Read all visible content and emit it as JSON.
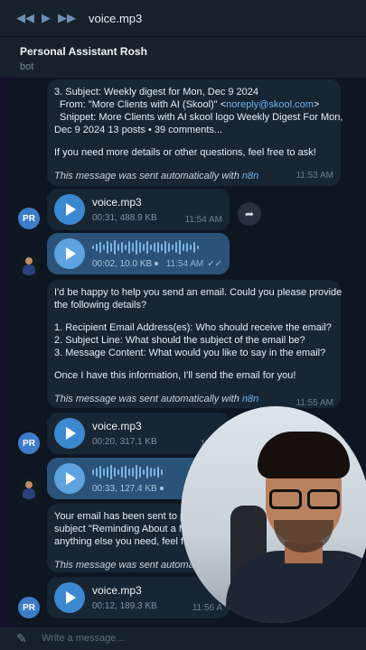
{
  "player": {
    "title": "voice.mp3"
  },
  "chat": {
    "name": "Personal Assistant Rosh",
    "subtitle": "bot"
  },
  "bot_avatar_initials": "PR",
  "messages": {
    "m1": {
      "lines": [
        "3. Subject: Weekly digest for Mon, Dec 9 2024",
        "From: \"More Clients with AI (Skool)\" <",
        "noreply@skool.com",
        ">",
        "Snippet: More Clients with AI skool logo Weekly Digest For Mon,",
        "Dec 9 2024 13 posts • 39 comments...",
        "If you need more details or other questions, feel free to ask!"
      ],
      "footer": "This message was sent automatically with ",
      "footer_link": "n8n",
      "time": "11:53 AM"
    },
    "v1": {
      "name": "voice.mp3",
      "meta": "00:31, 488.9 KB",
      "time": "11:54 AM"
    },
    "uv1": {
      "meta": "00:02, 10.0 KB",
      "time": "11:54 AM"
    },
    "m2": {
      "lines": [
        "I'd be happy to help you send an email. Could you please provide",
        "the following details?",
        "1. Recipient Email Address(es): Who should receive the email?",
        "2. Subject Line: What should the subject of the email be?",
        "3. Message Content: What would you like to say in the email?",
        "Once I have this information, I'll send the email for you!"
      ],
      "footer": "This message was sent automatically with ",
      "footer_link": "n8n",
      "time": "11:55 AM"
    },
    "v2": {
      "name": "voice.mp3",
      "meta": "00:20, 317.1 KB",
      "time": "11:55"
    },
    "uv2": {
      "meta": "00:33, 127.4 KB"
    },
    "m3": {
      "lines": [
        "Your email has been sent to pr",
        "subject \"Reminding About a Me",
        "anything else you need, feel fre"
      ],
      "footer": "This message was sent automatica"
    },
    "v3": {
      "name": "voice.mp3",
      "meta": "00:12, 189.3 KB",
      "time": "11:56 A"
    }
  },
  "composer": {
    "placeholder": "Write a message..."
  },
  "icons": {
    "share": "share-arrow-icon",
    "attach": "paperclip-icon"
  }
}
